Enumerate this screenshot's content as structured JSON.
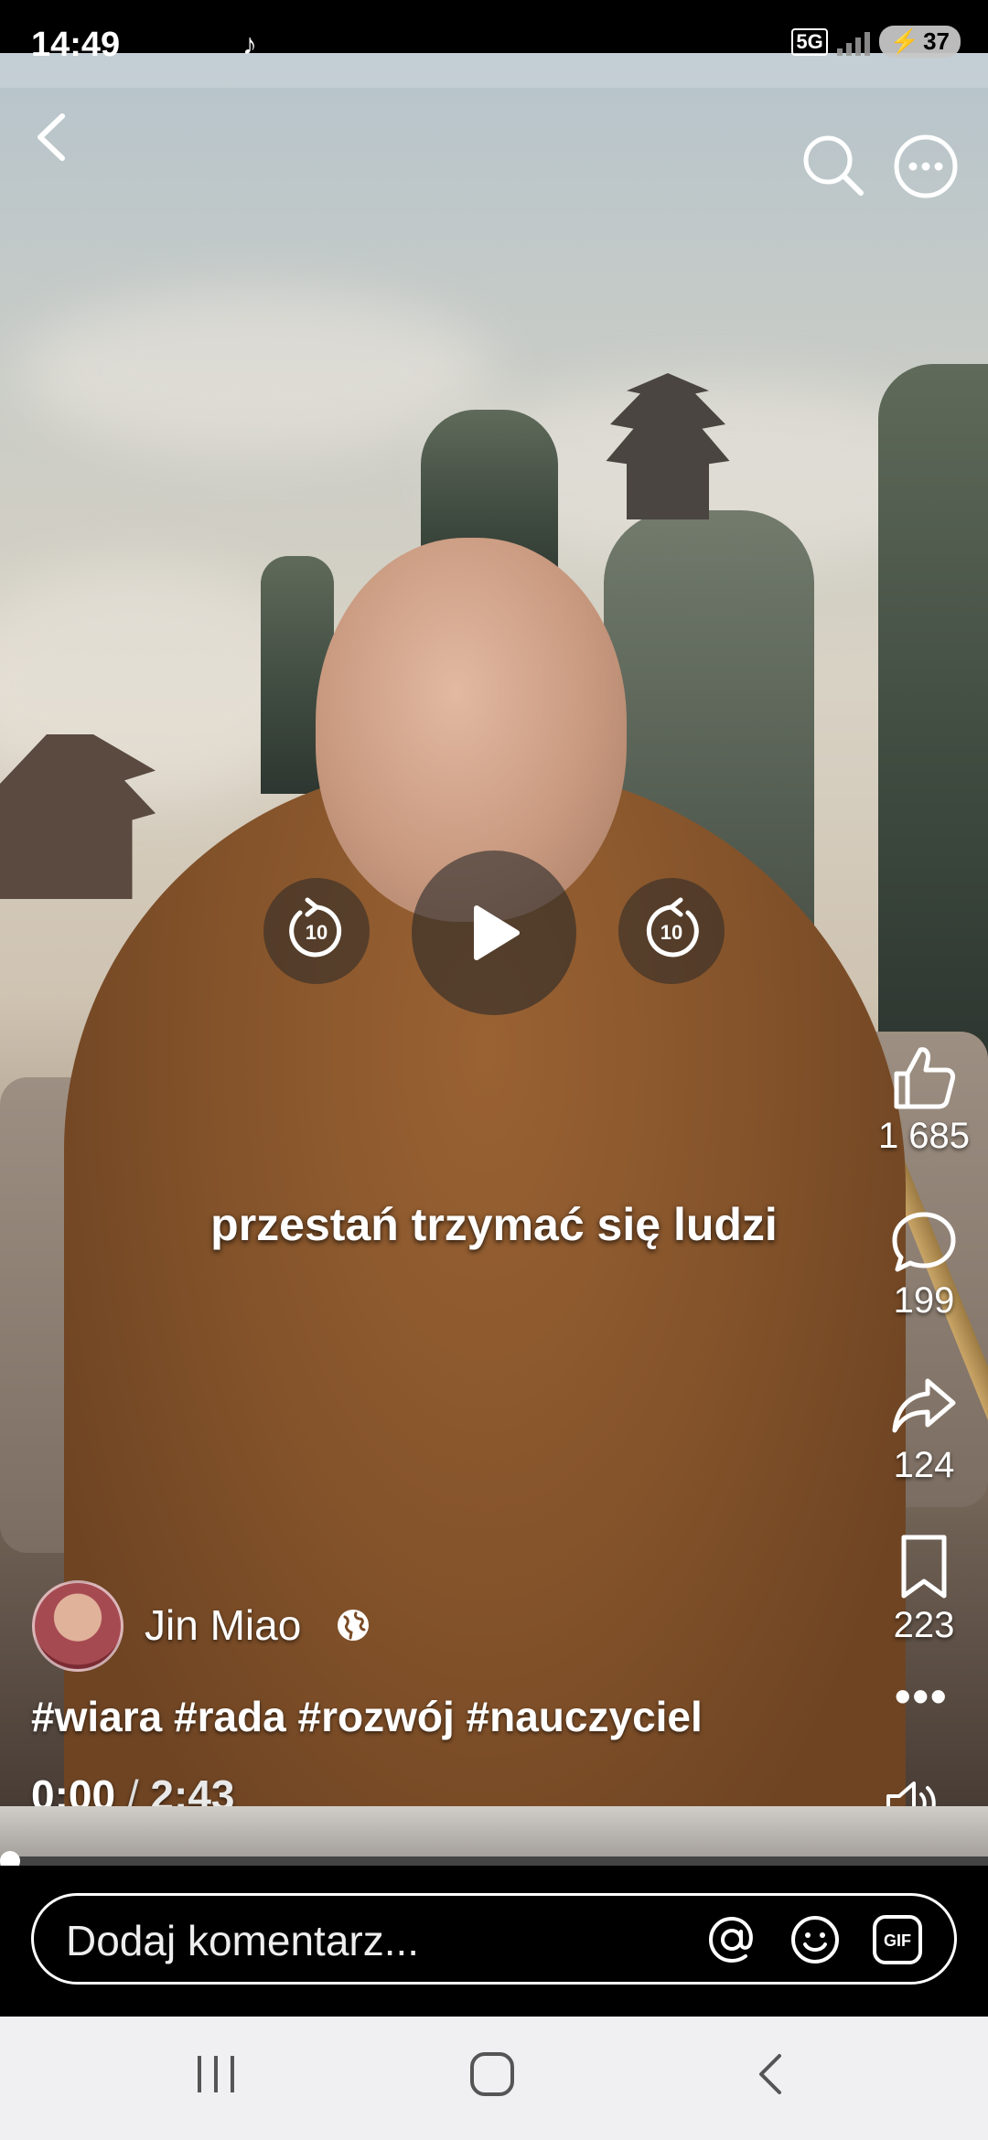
{
  "status_bar": {
    "time": "14:49",
    "network": "5G",
    "battery": "37"
  },
  "video": {
    "subtitle": "przestań trzymać się ludzi"
  },
  "player": {
    "rewind_label": "10",
    "forward_label": "10"
  },
  "actions": {
    "likes": "1 685",
    "comments": "199",
    "shares": "124",
    "saves": "223"
  },
  "author": {
    "name": "Jin Miao"
  },
  "caption": {
    "hashtags": "#wiara #rada #rozwój #nauczyciel"
  },
  "playback": {
    "current": "0:00",
    "separator": "/",
    "duration": "2:43",
    "progress_fraction": 0
  },
  "comment_bar": {
    "placeholder": "Dodaj komentarz...",
    "gif_label": "GIF"
  },
  "icons": {
    "back": "back-arrow-icon",
    "search": "search-icon",
    "more": "more-options-icon",
    "like": "thumbs-up-icon",
    "comment": "speech-bubble-icon",
    "share": "share-arrow-icon",
    "save": "bookmark-icon",
    "volume": "volume-icon",
    "globe": "globe-icon",
    "mention": "at-icon",
    "emoji": "emoji-icon",
    "gif": "gif-icon"
  }
}
